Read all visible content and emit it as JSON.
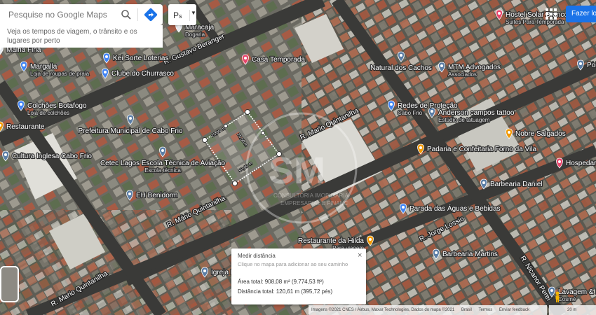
{
  "search": {
    "placeholder": "Pesquise no Google Maps",
    "hint": "Veja os tempos de viagem, o trânsito e os lugares por perto"
  },
  "layer_button": {
    "label": "P",
    "cursor": "s"
  },
  "signin": {
    "label": "Fazer log"
  },
  "streets": [
    {
      "id": "gustavo",
      "name": "R. Gustavo Beranger"
    },
    {
      "id": "quintanilha_ne",
      "name": "R. Mario Quintanilha"
    },
    {
      "id": "quintanilha_sw",
      "name": "R. Mário Quintanilha"
    },
    {
      "id": "quintanilha_far",
      "name": "R. Mario Quintanilha"
    },
    {
      "id": "lossio",
      "name": "R. Jorge Lossio"
    },
    {
      "id": "nicanor",
      "name": "R. Nicanor Perei"
    }
  ],
  "places": [
    {
      "id": "maracaja",
      "name": "Maracaja",
      "sub": "Dogaria",
      "icon": "pin-icon",
      "color": "#e7ebf0"
    },
    {
      "id": "malha",
      "name": "Malha Fina",
      "sub": "",
      "icon": "pin-icon",
      "color": "#e7ebf0"
    },
    {
      "id": "keisorte",
      "name": "Kei Sorte Loterias",
      "sub": "",
      "icon": "shopping-icon",
      "color": "#4285f4"
    },
    {
      "id": "margalla",
      "name": "Margalla",
      "sub": "Loja de roupas de praia",
      "icon": "shopping-icon",
      "color": "#4285f4"
    },
    {
      "id": "churrasco",
      "name": "Clube do Churrasco",
      "sub": "",
      "icon": "shopping-icon",
      "color": "#4285f4"
    },
    {
      "id": "colchoes",
      "name": "Colchões Botafogo",
      "sub": "Loja de colchões",
      "icon": "shopping-icon",
      "color": "#4285f4"
    },
    {
      "id": "restaurante",
      "name": "Restaurante",
      "sub": "",
      "icon": "food-icon",
      "color": "#f29900"
    },
    {
      "id": "casatemp",
      "name": "Casa Temporada",
      "sub": "",
      "icon": "lodging-icon",
      "color": "#e8466c"
    },
    {
      "id": "natural",
      "name": "Natural dos Cachos",
      "sub": "",
      "icon": "pin-icon",
      "color": "#5c7ea6"
    },
    {
      "id": "hostel",
      "name": "Hostel Solar Branco",
      "sub": "Suites Para Temporada",
      "icon": "lodging-icon",
      "color": "#e8466c"
    },
    {
      "id": "mtm",
      "name": "MTM Advogados",
      "sub": "Associados",
      "icon": "pin-icon",
      "color": "#5c7ea6"
    },
    {
      "id": "point",
      "name": "Point",
      "sub": "",
      "icon": "pin-icon",
      "color": "#5c7ea6"
    },
    {
      "id": "anderson",
      "name": "Anderson campos tattoo",
      "sub": "Estúdio de tatuagem",
      "icon": "pin-icon",
      "color": "#5c7ea6"
    },
    {
      "id": "redes",
      "name": "Redes de Proteção",
      "sub": "Cabo Frio",
      "icon": "shopping-icon",
      "color": "#4285f4"
    },
    {
      "id": "prefeitura",
      "name": "Prefeitura Municipal de Cabo Frio",
      "sub": "",
      "icon": "civic-icon",
      "color": "#5c7ea6"
    },
    {
      "id": "cetec",
      "name": "Cetec Lagos Escola Técnica de Aviação",
      "sub": "Escola técnica",
      "icon": "school-icon",
      "color": "#5c7ea6"
    },
    {
      "id": "nobre",
      "name": "Nobre Salgados",
      "sub": "",
      "icon": "food-icon",
      "color": "#f29900"
    },
    {
      "id": "hospedaria",
      "name": "Hospedaria de Paulo Cabo Frio",
      "sub": "",
      "icon": "lodging-icon",
      "color": "#e8466c"
    },
    {
      "id": "padaria",
      "name": "Padaria e Confeitaria Forno da Vila",
      "sub": "",
      "icon": "food-icon",
      "color": "#f29900"
    },
    {
      "id": "ebbenidorm",
      "name": "EH Benidorm",
      "sub": "",
      "icon": "pin-icon",
      "color": "#5c7ea6"
    },
    {
      "id": "barbearia_daniel",
      "name": "Barbearia Daniel",
      "sub": "",
      "icon": "pin-icon",
      "color": "#5c7ea6"
    },
    {
      "id": "cultura",
      "name": "Cultura Inglesa Cabo Frio",
      "sub": "",
      "icon": "school-icon",
      "color": "#5c7ea6"
    },
    {
      "id": "parada",
      "name": "Parada das Águas e Bebidas",
      "sub": "",
      "icon": "shopping-icon",
      "color": "#4285f4"
    },
    {
      "id": "hilda",
      "name": "Restaurante da Hilda",
      "sub": "Para viagem",
      "icon": "food-icon",
      "color": "#f29900"
    },
    {
      "id": "barbearia_martins",
      "name": "Barbearia Martins",
      "sub": "",
      "icon": "pin-icon",
      "color": "#5c7ea6"
    },
    {
      "id": "igreja",
      "name": "Igreja Fi",
      "sub": "",
      "icon": "pin-icon",
      "color": "#5c7ea6"
    },
    {
      "id": "lavagem",
      "name": "Lavagem & Po",
      "sub": "Cosmé",
      "icon": "pin-icon",
      "color": "#5c7ea6"
    }
  ],
  "measure_labels": {
    "side_a": "20,00 m",
    "side_b": "50,00 m",
    "side_c": "20,00 m"
  },
  "watermark": {
    "mark": "SM",
    "line1": "CONSULTORIA IMOBILIÁRIA",
    "line2": "EMPRESARIAL E FINANC"
  },
  "measure_panel": {
    "title": "Medir distância",
    "instruction": "Clique no mapa para adicionar ao seu caminho",
    "area": "Área total: 908,08 m² (9.774,53 ft²)",
    "distance": "Distância total: 120,61 m (395,72 pés)"
  },
  "footer": {
    "attribution": "Imagens ©2021 CNES / Airbus, Maxar Technologies, Dados do mapa ©2021",
    "country": "Brasil",
    "terms": "Termos",
    "feedback": "Enviar feedback",
    "scale": "20 m"
  }
}
